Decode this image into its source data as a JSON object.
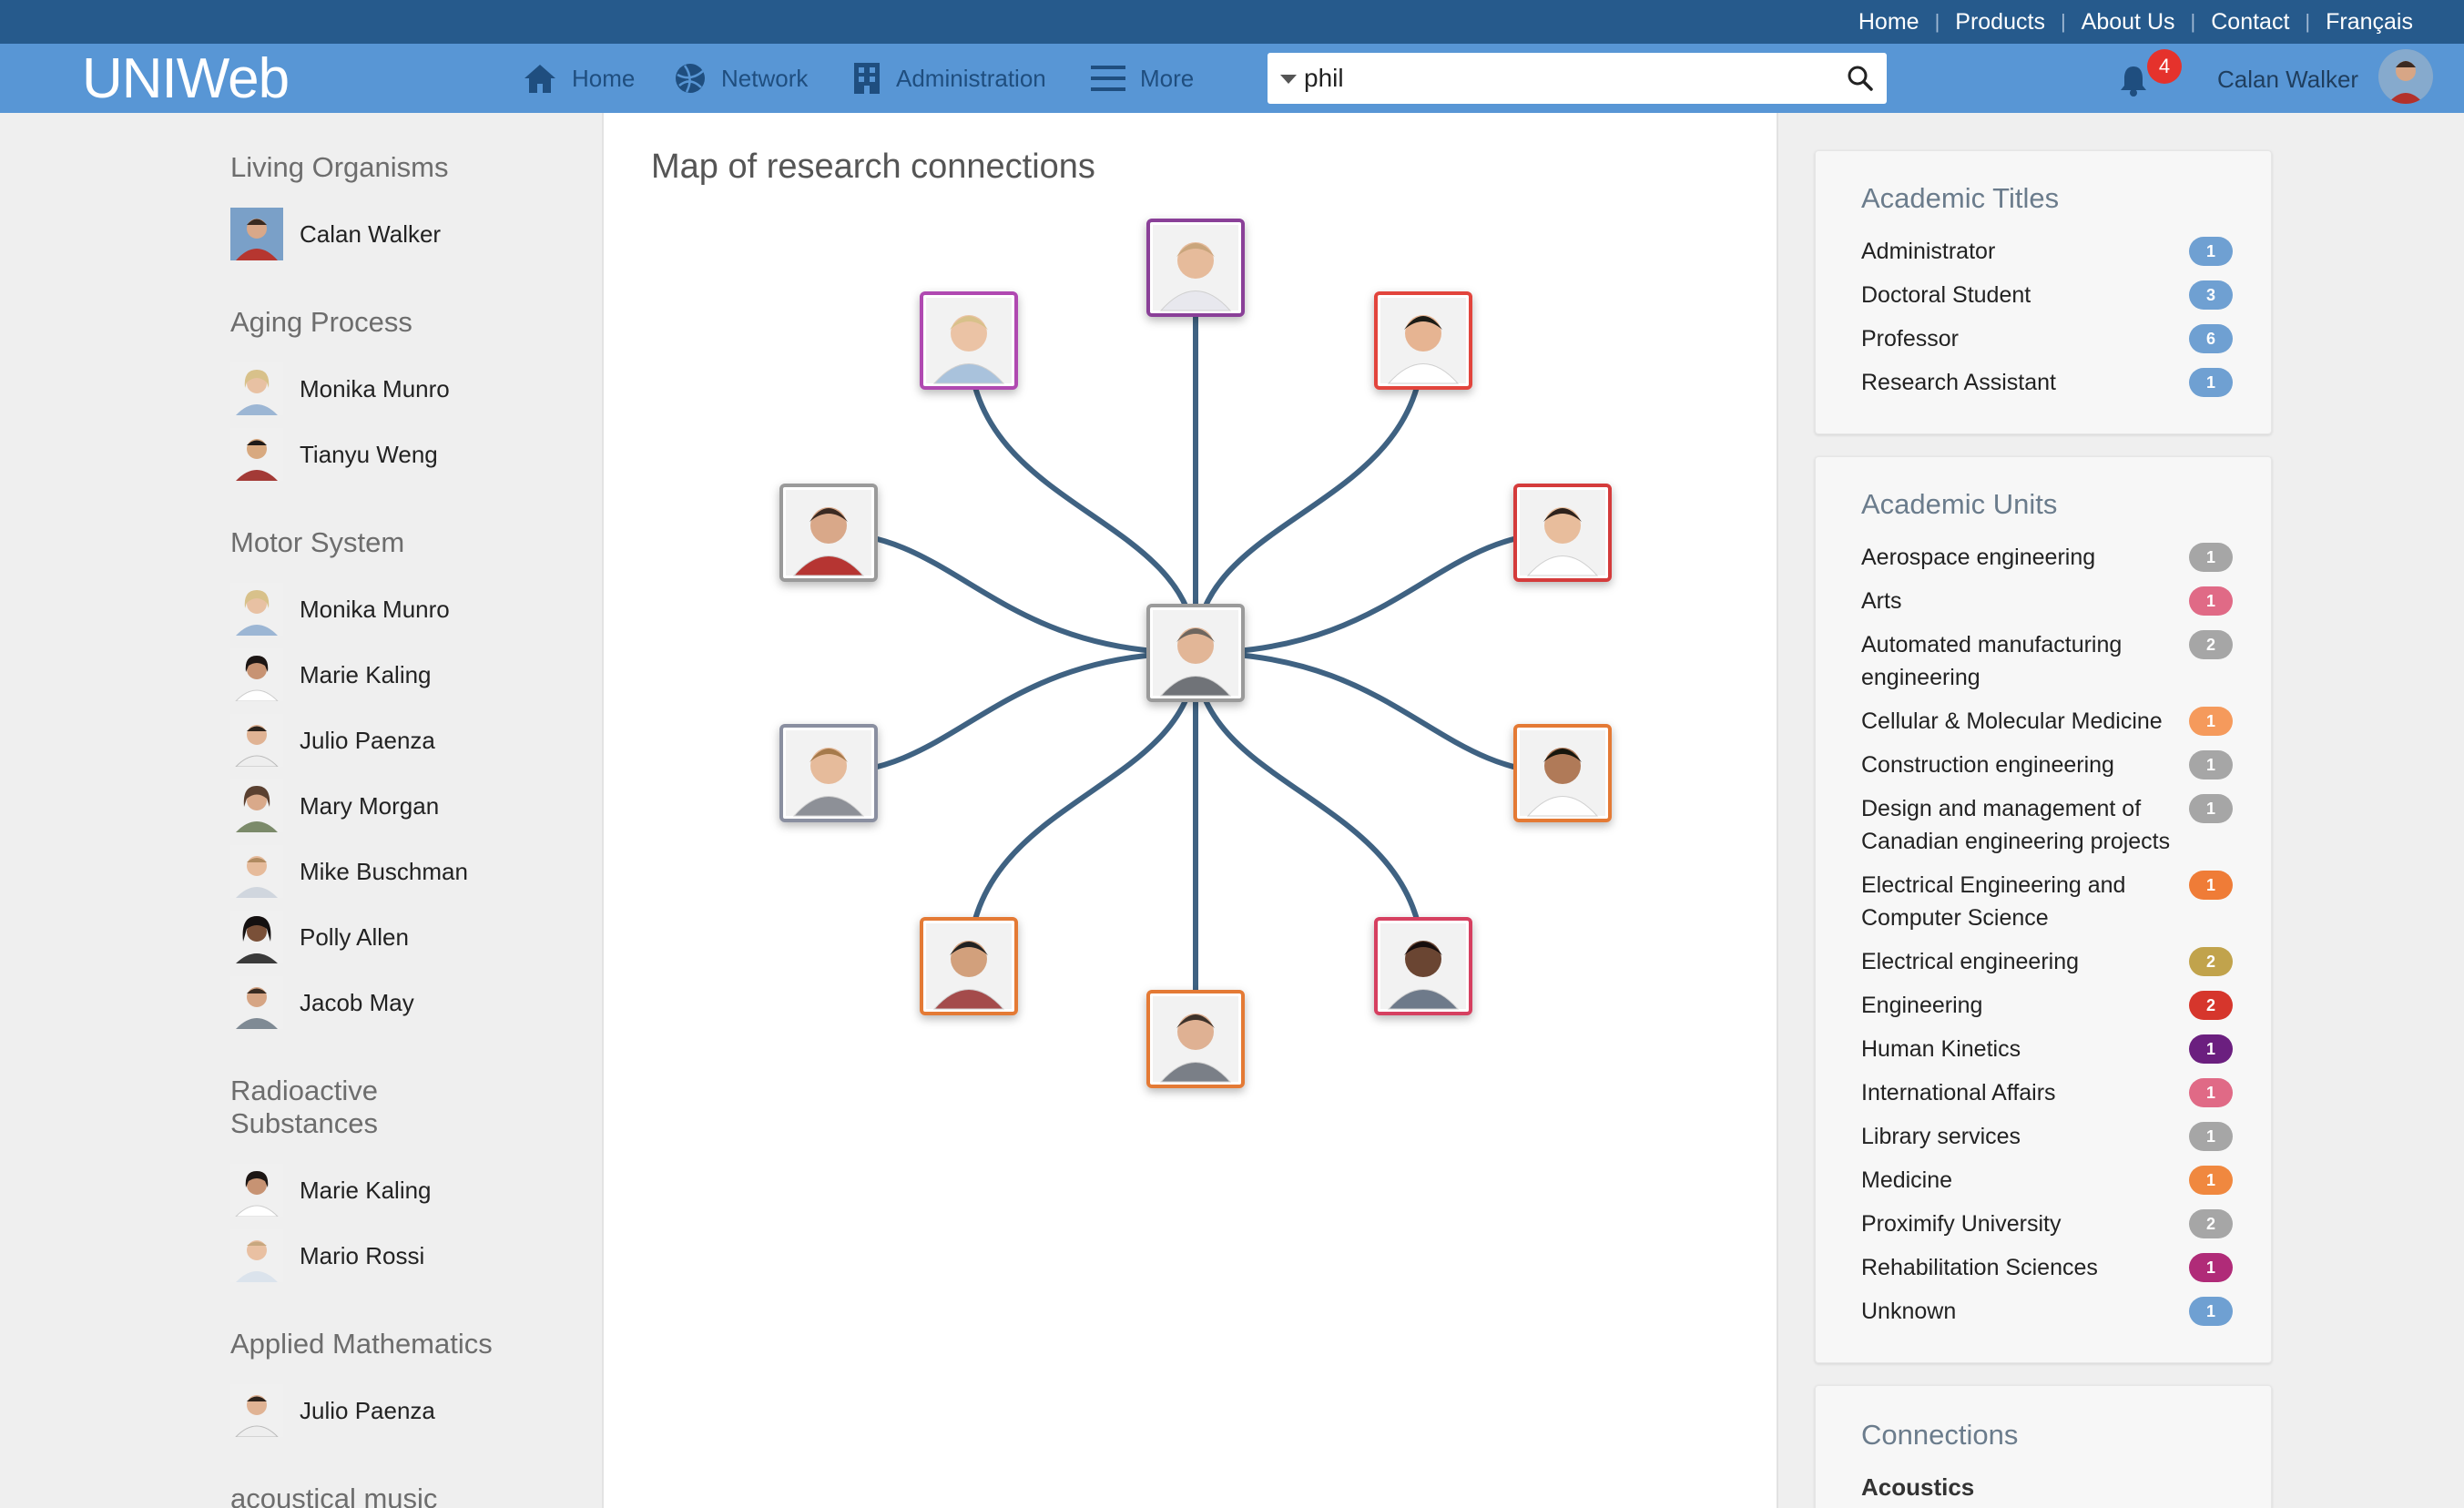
{
  "topnav": {
    "links": [
      "Home",
      "Products",
      "About Us",
      "Contact",
      "Français"
    ]
  },
  "header": {
    "logo": "UNIWeb",
    "nav": [
      {
        "label": "Home",
        "icon": "home-icon"
      },
      {
        "label": "Network",
        "icon": "globe-icon"
      },
      {
        "label": "Administration",
        "icon": "building-icon"
      },
      {
        "label": "More",
        "icon": "menu-icon"
      }
    ],
    "search": {
      "value": "phil",
      "placeholder": ""
    },
    "notifications": "4",
    "user_name": "Calan Walker"
  },
  "sidebar": {
    "sections": [
      {
        "title": "Living Organisms",
        "people": [
          "Calan Walker"
        ]
      },
      {
        "title": "Aging Process",
        "people": [
          "Monika Munro",
          "Tianyu Weng"
        ]
      },
      {
        "title": "Motor System",
        "people": [
          "Monika Munro",
          "Marie Kaling",
          "Julio Paenza",
          "Mary Morgan",
          "Mike Buschman",
          "Polly Allen",
          "Jacob May"
        ]
      },
      {
        "title": "Radioactive Substances",
        "people": [
          "Marie Kaling",
          "Mario Rossi"
        ]
      },
      {
        "title": "Applied Mathematics",
        "people": [
          "Julio Paenza"
        ]
      },
      {
        "title": "acoustical music",
        "people": []
      }
    ]
  },
  "main": {
    "title": "Map of research connections"
  },
  "academic_titles": {
    "title": "Academic Titles",
    "items": [
      {
        "label": "Administrator",
        "count": "1",
        "color": "#6fa0d2"
      },
      {
        "label": "Doctoral Student",
        "count": "3",
        "color": "#6fa0d2"
      },
      {
        "label": "Professor",
        "count": "6",
        "color": "#6fa0d2"
      },
      {
        "label": "Research Assistant",
        "count": "1",
        "color": "#6fa0d2"
      }
    ]
  },
  "academic_units": {
    "title": "Academic Units",
    "items": [
      {
        "label": "Aerospace engineering",
        "count": "1",
        "color": "#a6a6a6"
      },
      {
        "label": "Arts",
        "count": "1",
        "color": "#e06a86"
      },
      {
        "label": "Automated manufacturing engineering",
        "count": "2",
        "color": "#a6a6a6"
      },
      {
        "label": "Cellular & Molecular Medicine",
        "count": "1",
        "color": "#f59a5c"
      },
      {
        "label": "Construction engineering",
        "count": "1",
        "color": "#a6a6a6"
      },
      {
        "label": "Design and management of Canadian engineering projects",
        "count": "1",
        "color": "#a6a6a6"
      },
      {
        "label": "Electrical Engineering and Computer Science",
        "count": "1",
        "color": "#ef7c37"
      },
      {
        "label": "Electrical engineering",
        "count": "2",
        "color": "#c1a34c"
      },
      {
        "label": "Engineering",
        "count": "2",
        "color": "#d6362c"
      },
      {
        "label": "Human Kinetics",
        "count": "1",
        "color": "#6b1f7f"
      },
      {
        "label": "International Affairs",
        "count": "1",
        "color": "#e06a86"
      },
      {
        "label": "Library services",
        "count": "1",
        "color": "#a6a6a6"
      },
      {
        "label": "Medicine",
        "count": "1",
        "color": "#f0883f"
      },
      {
        "label": "Proximify University",
        "count": "2",
        "color": "#a6a6a6"
      },
      {
        "label": "Rehabilitation Sciences",
        "count": "1",
        "color": "#b02b78"
      },
      {
        "label": "Unknown",
        "count": "1",
        "color": "#6fa0d2"
      }
    ]
  },
  "connections": {
    "title": "Connections",
    "first_item": "Acoustics"
  },
  "network": {
    "edge_color": "#3f6282",
    "node_border_colors": [
      "#8a3f98",
      "#b04ab1",
      "#e2443c",
      "#d43a3a",
      "#e47a34",
      "#d64160",
      "#e47a34",
      "#e47a34",
      "#9a9a9a",
      "#8a8fa0",
      "#9a9a9a"
    ]
  }
}
